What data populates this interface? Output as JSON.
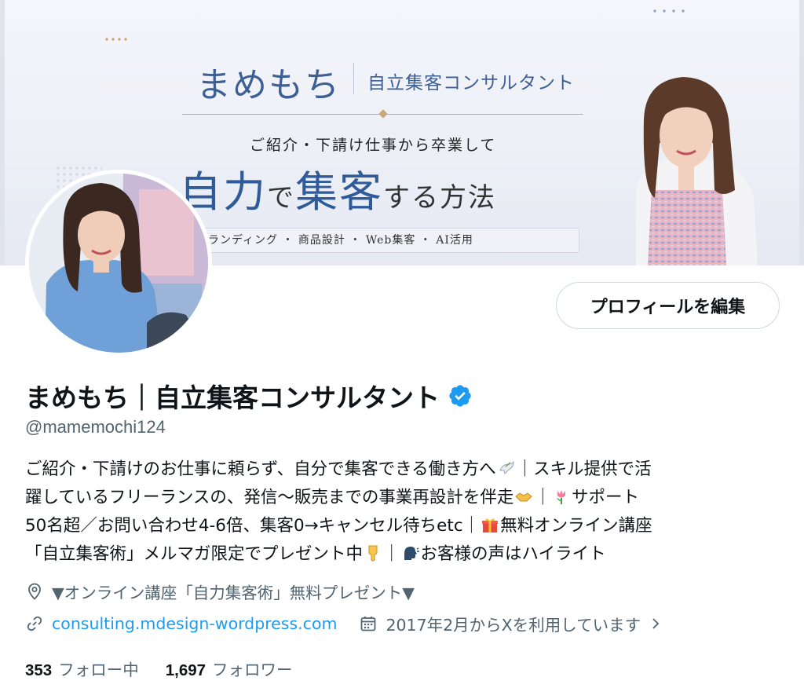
{
  "banner": {
    "brand": "まめもち",
    "role": "自立集客コンサルタント",
    "subtitle": "ご紹介・下請け仕事から卒業して",
    "headline_a": "自力",
    "headline_b": "で",
    "headline_c": "集客",
    "headline_d": "する方法",
    "tags": "ランディング ・ 商品設計 ・ Web集客 ・ AI活用"
  },
  "profile": {
    "edit_button": "プロフィールを編集",
    "name": "まめもち｜自立集客コンサルタント",
    "verified_icon": "verified-badge-icon",
    "handle": "@mamemochi124",
    "bio": {
      "l1a": "ご紹介・下請けのお仕事に頼らず、自分で集客できる働き方へ",
      "l1b": "｜スキル提供で活",
      "l2a": "躍しているフリーランスの、発信〜販売までの事業再設計を伴走",
      "l2b": "｜",
      "l2c": "サポート",
      "l3a": "50名超／お問い合わせ4-6倍、集客0→キャンセル待ちetc｜",
      "l3b": "無料オンライン講座",
      "l4a": "「自立集客術」メルマガ限定でプレゼント中",
      "l4b": "｜",
      "l4c": "お客様の声はハイライト"
    },
    "location": "▼オンライン講座「自力集客術」無料プレゼント▼",
    "website": "consulting.mdesign-wordpress.com",
    "joined": "2017年2月からXを利用しています",
    "following_count": "353",
    "following_label": "フォロー中",
    "followers_count": "1,697",
    "followers_label": "フォロワー"
  },
  "colors": {
    "accent": "#1d9bf0",
    "secondary_text": "#536471",
    "banner_blue": "#2f5b9a"
  }
}
